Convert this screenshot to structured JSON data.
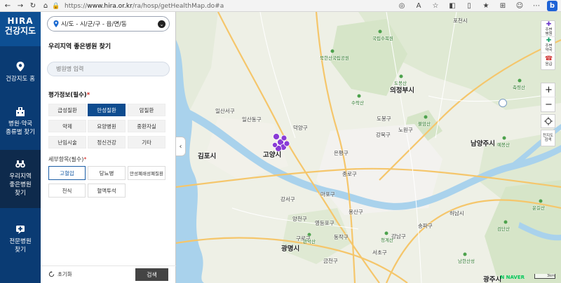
{
  "browser": {
    "url_scheme": "https://",
    "url_host": "www.hira.or.kr",
    "url_path": "/ra/hosp/getHealthMap.do#a"
  },
  "brand": {
    "line1": "HIRA",
    "line2": "건강지도"
  },
  "leftnav": {
    "items": [
      {
        "label": "건강지도 홈"
      },
      {
        "label_l1": "병원·약국",
        "label_l2": "종류별 찾기"
      },
      {
        "label_l1": "우리지역",
        "label_l2": "좋은병원",
        "label_l3": "찾기"
      },
      {
        "label_l1": "전문병원",
        "label_l2": "찾기"
      }
    ]
  },
  "panel": {
    "region": "시/도 - 시/군/구 - 읍/면/동",
    "title": "우리지역 좋은병원 찾기",
    "search_placeholder": "병원명 입력",
    "eval_title": "평가정보(필수)",
    "eval_items": [
      "급성질환",
      "만성질환",
      "암질환",
      "약제",
      "요양병원",
      "중환자실",
      "난임시술",
      "정신건강",
      "기타"
    ],
    "eval_selected": "만성질환",
    "detail_title": "세부항목(필수)",
    "detail_items": [
      "고혈압",
      "당뇨병",
      "만성폐쇄성폐질환",
      "천식",
      "혈액투석"
    ],
    "detail_selected": "고혈압",
    "reset_label": "초기화",
    "search_label": "검색",
    "required_mark": "*"
  },
  "map": {
    "labels": {
      "gimpo": "김포시",
      "goyang": "고양시",
      "ilsanseo": "일산서구",
      "ilsandong": "일산동구",
      "deogyang": "덕양구",
      "uijeongbu": "의정부시",
      "namyangju": "남양주시",
      "gangbuk": "강북구",
      "nowon": "노원구",
      "dobong": "도봉구",
      "gwangmyeong": "광명시",
      "gwangju": "광주시",
      "yongsan": "용산구",
      "gangnam": "강남구",
      "mapo": "마포구",
      "eunpyeong": "은평구",
      "jongno": "종로구",
      "seocho": "서초구",
      "dongjak": "동작구",
      "geumcheon": "금천구",
      "songpa": "송파구",
      "hanam": "하남시",
      "gangseo": "강서구",
      "yangcheon": "양천구",
      "guro": "구로구",
      "yeongdeungpo": "영등포구",
      "pocheon": "포천시"
    },
    "park_labels": [
      "국립수목원",
      "북한산국립공원",
      "도봉산",
      "불암산",
      "수락산",
      "관악산",
      "청계산",
      "남한산성",
      "검단산",
      "축령산",
      "예봉산",
      "운길산"
    ],
    "tools": [
      {
        "glyph": "✚",
        "line1": "주변",
        "line2": "병원"
      },
      {
        "glyph": "✚",
        "line1": "주변",
        "line2": "약국"
      },
      {
        "glyph": "☎",
        "line1": "응급",
        "line2": ""
      }
    ],
    "zoom_in": "+",
    "zoom_out": "−",
    "overview_line1": "전지도",
    "overview_line2": "검색",
    "naver": "N NAVER",
    "scale": "3km",
    "marker_color": "#8a3bd6"
  }
}
